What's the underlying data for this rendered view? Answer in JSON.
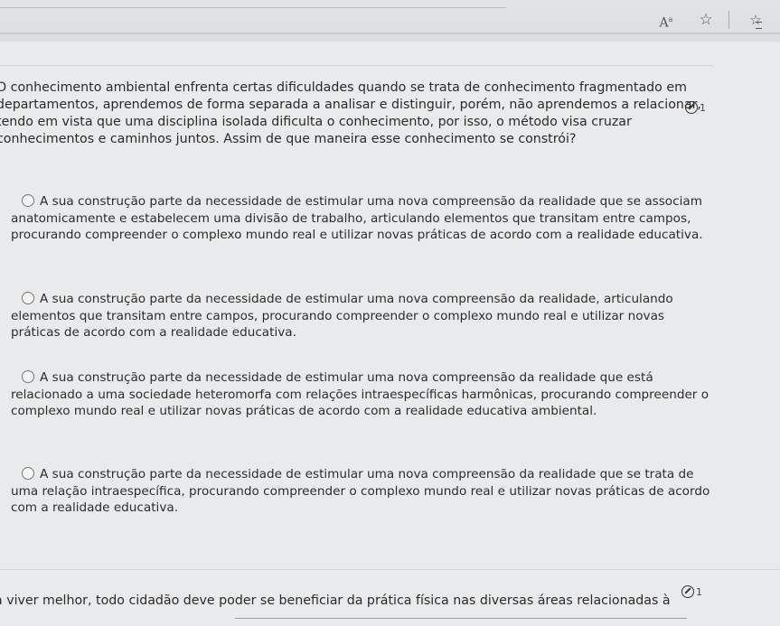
{
  "toolbar": {
    "reader_icon_label": "A",
    "reader_icon_sup": "a",
    "icons": [
      "reader-view-icon",
      "favorite-star-icon",
      "favorites-list-icon"
    ]
  },
  "question": {
    "text": "O conhecimento ambiental enfrenta certas dificuldades quando se trata de conhecimento fragmentado em departamentos, aprendemos de forma separada a analisar e distinguir, porém, não aprendemos a relacionar, tendo em vista que uma disciplina isolada dificulta o conhecimento, por isso, o método visa cruzar conhecimentos e caminhos juntos. Assim de que maneira esse conhecimento se constrói?",
    "badge": "1"
  },
  "options": [
    {
      "text": "A sua construção parte da necessidade de estimular uma nova compreensão da realidade que se associam anatomicamente e estabelecem uma divisão de trabalho, articulando elementos que transitam entre campos, procurando compreender o complexo mundo real e utilizar novas práticas de acordo com a realidade educativa."
    },
    {
      "text": "A sua construção parte da necessidade de estimular uma nova compreensão da realidade, articulando elementos que transitam entre campos, procurando compreender o complexo mundo real e utilizar novas práticas de acordo com a realidade educativa."
    },
    {
      "text": "A sua construção parte da necessidade de estimular uma nova compreensão da realidade que está relacionado a uma sociedade heteromorfa com relações intraespecíficas harmônicas, procurando compreender o complexo mundo real e utilizar novas práticas de acordo com a realidade educativa ambiental."
    },
    {
      "text": "A sua construção parte da necessidade de estimular uma nova compreensão da realidade que se trata de uma relação intraespecífica, procurando compreender o complexo mundo real e utilizar novas práticas de acordo com a realidade educativa."
    }
  ],
  "next_question": {
    "text": "a viver melhor, todo cidadão deve poder se beneficiar da prática física nas diversas áreas relacionadas à",
    "badge": "1"
  }
}
